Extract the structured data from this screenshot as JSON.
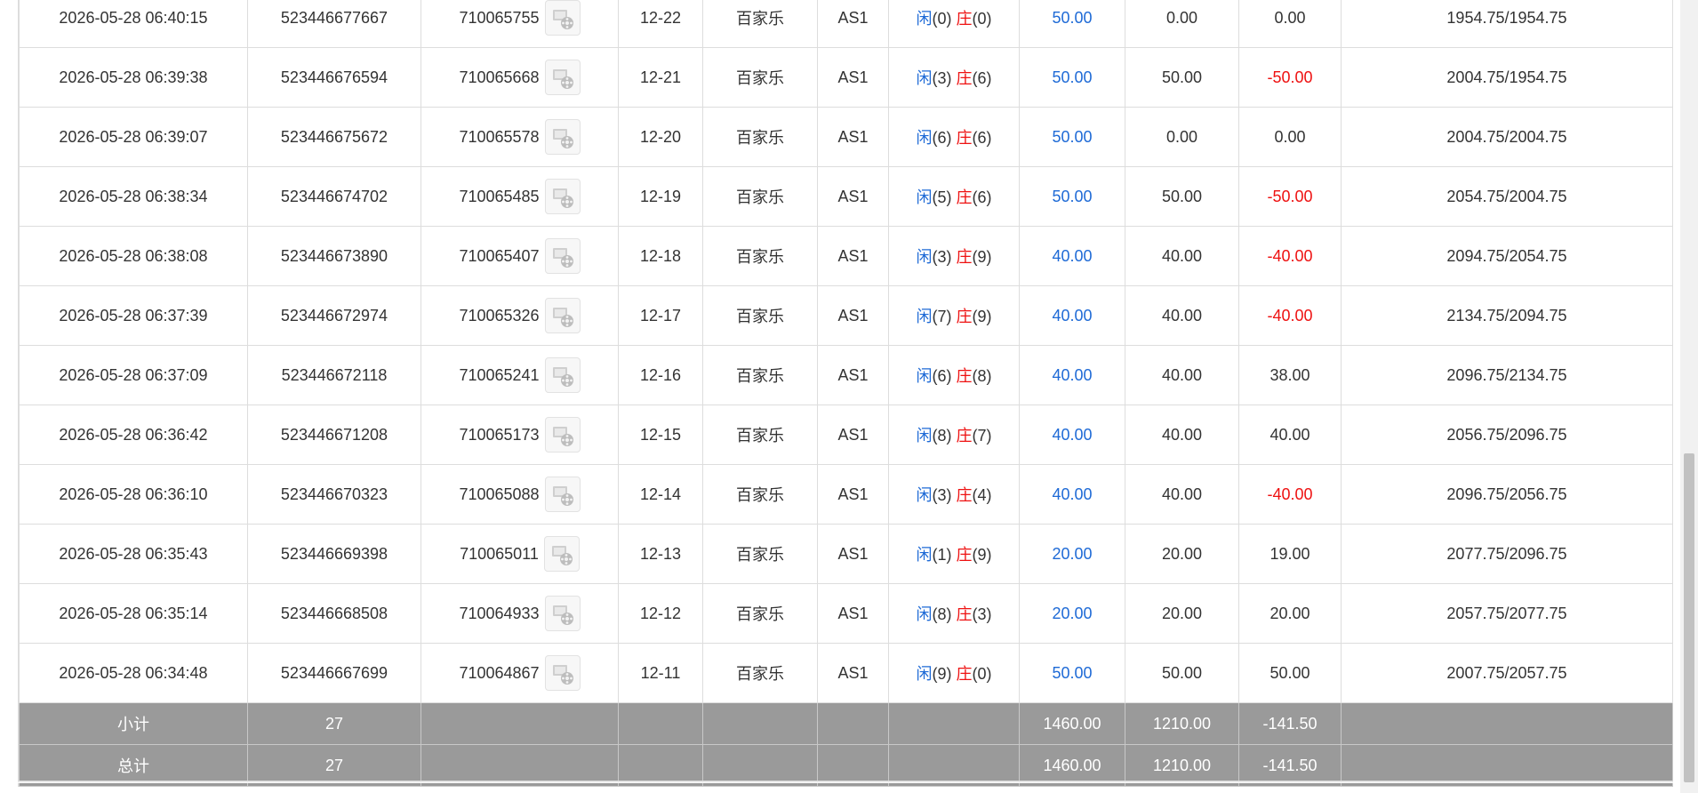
{
  "rows": [
    {
      "time": "2026-05-28 06:40:15",
      "order": "523446677667",
      "round": "710065755",
      "shoe": "12-22",
      "game": "百家乐",
      "table": "AS1",
      "p": "0",
      "b": "0",
      "bet": "50.00",
      "valid": "0.00",
      "win": "0.00",
      "win_neg": false,
      "balance": "1954.75/1954.75"
    },
    {
      "time": "2026-05-28 06:39:38",
      "order": "523446676594",
      "round": "710065668",
      "shoe": "12-21",
      "game": "百家乐",
      "table": "AS1",
      "p": "3",
      "b": "6",
      "bet": "50.00",
      "valid": "50.00",
      "win": "-50.00",
      "win_neg": true,
      "balance": "2004.75/1954.75"
    },
    {
      "time": "2026-05-28 06:39:07",
      "order": "523446675672",
      "round": "710065578",
      "shoe": "12-20",
      "game": "百家乐",
      "table": "AS1",
      "p": "6",
      "b": "6",
      "bet": "50.00",
      "valid": "0.00",
      "win": "0.00",
      "win_neg": false,
      "balance": "2004.75/2004.75"
    },
    {
      "time": "2026-05-28 06:38:34",
      "order": "523446674702",
      "round": "710065485",
      "shoe": "12-19",
      "game": "百家乐",
      "table": "AS1",
      "p": "5",
      "b": "6",
      "bet": "50.00",
      "valid": "50.00",
      "win": "-50.00",
      "win_neg": true,
      "balance": "2054.75/2004.75"
    },
    {
      "time": "2026-05-28 06:38:08",
      "order": "523446673890",
      "round": "710065407",
      "shoe": "12-18",
      "game": "百家乐",
      "table": "AS1",
      "p": "3",
      "b": "9",
      "bet": "40.00",
      "valid": "40.00",
      "win": "-40.00",
      "win_neg": true,
      "balance": "2094.75/2054.75"
    },
    {
      "time": "2026-05-28 06:37:39",
      "order": "523446672974",
      "round": "710065326",
      "shoe": "12-17",
      "game": "百家乐",
      "table": "AS1",
      "p": "7",
      "b": "9",
      "bet": "40.00",
      "valid": "40.00",
      "win": "-40.00",
      "win_neg": true,
      "balance": "2134.75/2094.75"
    },
    {
      "time": "2026-05-28 06:37:09",
      "order": "523446672118",
      "round": "710065241",
      "shoe": "12-16",
      "game": "百家乐",
      "table": "AS1",
      "p": "6",
      "b": "8",
      "bet": "40.00",
      "valid": "40.00",
      "win": "38.00",
      "win_neg": false,
      "balance": "2096.75/2134.75"
    },
    {
      "time": "2026-05-28 06:36:42",
      "order": "523446671208",
      "round": "710065173",
      "shoe": "12-15",
      "game": "百家乐",
      "table": "AS1",
      "p": "8",
      "b": "7",
      "bet": "40.00",
      "valid": "40.00",
      "win": "40.00",
      "win_neg": false,
      "balance": "2056.75/2096.75"
    },
    {
      "time": "2026-05-28 06:36:10",
      "order": "523446670323",
      "round": "710065088",
      "shoe": "12-14",
      "game": "百家乐",
      "table": "AS1",
      "p": "3",
      "b": "4",
      "bet": "40.00",
      "valid": "40.00",
      "win": "-40.00",
      "win_neg": true,
      "balance": "2096.75/2056.75"
    },
    {
      "time": "2026-05-28 06:35:43",
      "order": "523446669398",
      "round": "710065011",
      "shoe": "12-13",
      "game": "百家乐",
      "table": "AS1",
      "p": "1",
      "b": "9",
      "bet": "20.00",
      "valid": "20.00",
      "win": "19.00",
      "win_neg": false,
      "balance": "2077.75/2096.75"
    },
    {
      "time": "2026-05-28 06:35:14",
      "order": "523446668508",
      "round": "710064933",
      "shoe": "12-12",
      "game": "百家乐",
      "table": "AS1",
      "p": "8",
      "b": "3",
      "bet": "20.00",
      "valid": "20.00",
      "win": "20.00",
      "win_neg": false,
      "balance": "2057.75/2077.75"
    },
    {
      "time": "2026-05-28 06:34:48",
      "order": "523446667699",
      "round": "710064867",
      "shoe": "12-11",
      "game": "百家乐",
      "table": "AS1",
      "p": "9",
      "b": "0",
      "bet": "50.00",
      "valid": "50.00",
      "win": "50.00",
      "win_neg": false,
      "balance": "2007.75/2057.75"
    }
  ],
  "labels": {
    "player": "闲",
    "banker": "庄"
  },
  "icon": {
    "name": "film-reel-image-icon"
  },
  "colors": {
    "bet": "#1e6ad6",
    "negative": "#ee1111",
    "summary_bg": "#9a9a9a"
  },
  "subtotal": {
    "label": "小计",
    "count": "27",
    "bet": "1460.00",
    "valid": "1210.00",
    "win": "-141.50"
  },
  "total": {
    "label": "总计",
    "count": "27",
    "bet": "1460.00",
    "valid": "1210.00",
    "win": "-141.50"
  }
}
